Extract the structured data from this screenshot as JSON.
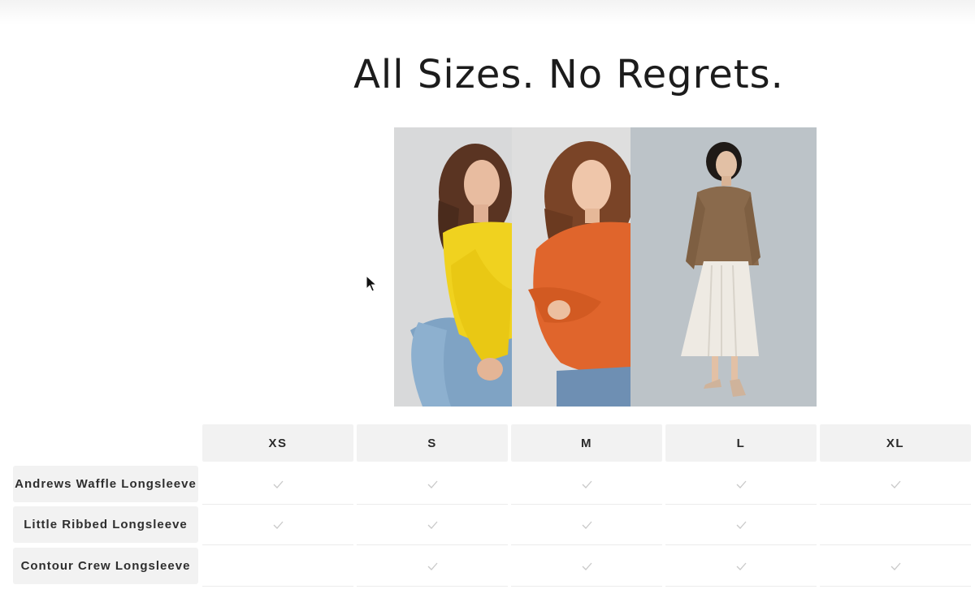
{
  "header": {
    "title": "All Sizes. No Regrets."
  },
  "collage": {
    "photos": [
      {
        "name": "yellow-sweater-model",
        "sweater_color": "#f0d21f"
      },
      {
        "name": "orange-sweater-model",
        "sweater_color": "#e0652c"
      },
      {
        "name": "brown-sweater-model",
        "sweater_color": "#8a6a4c"
      }
    ]
  },
  "size_chart": {
    "sizes": [
      "XS",
      "S",
      "M",
      "L",
      "XL"
    ],
    "products": [
      {
        "name": "Andrews Waffle Longsleeve",
        "available": [
          true,
          true,
          true,
          true,
          true
        ]
      },
      {
        "name": "Little Ribbed Longsleeve",
        "available": [
          true,
          true,
          true,
          true,
          false
        ]
      },
      {
        "name": "Contour Crew Longsleeve",
        "available": [
          false,
          true,
          true,
          true,
          true
        ]
      }
    ]
  },
  "colors": {
    "check": "#c9c9c9",
    "cell_background": "#f2f2f2",
    "text": "#1c1c1c"
  }
}
